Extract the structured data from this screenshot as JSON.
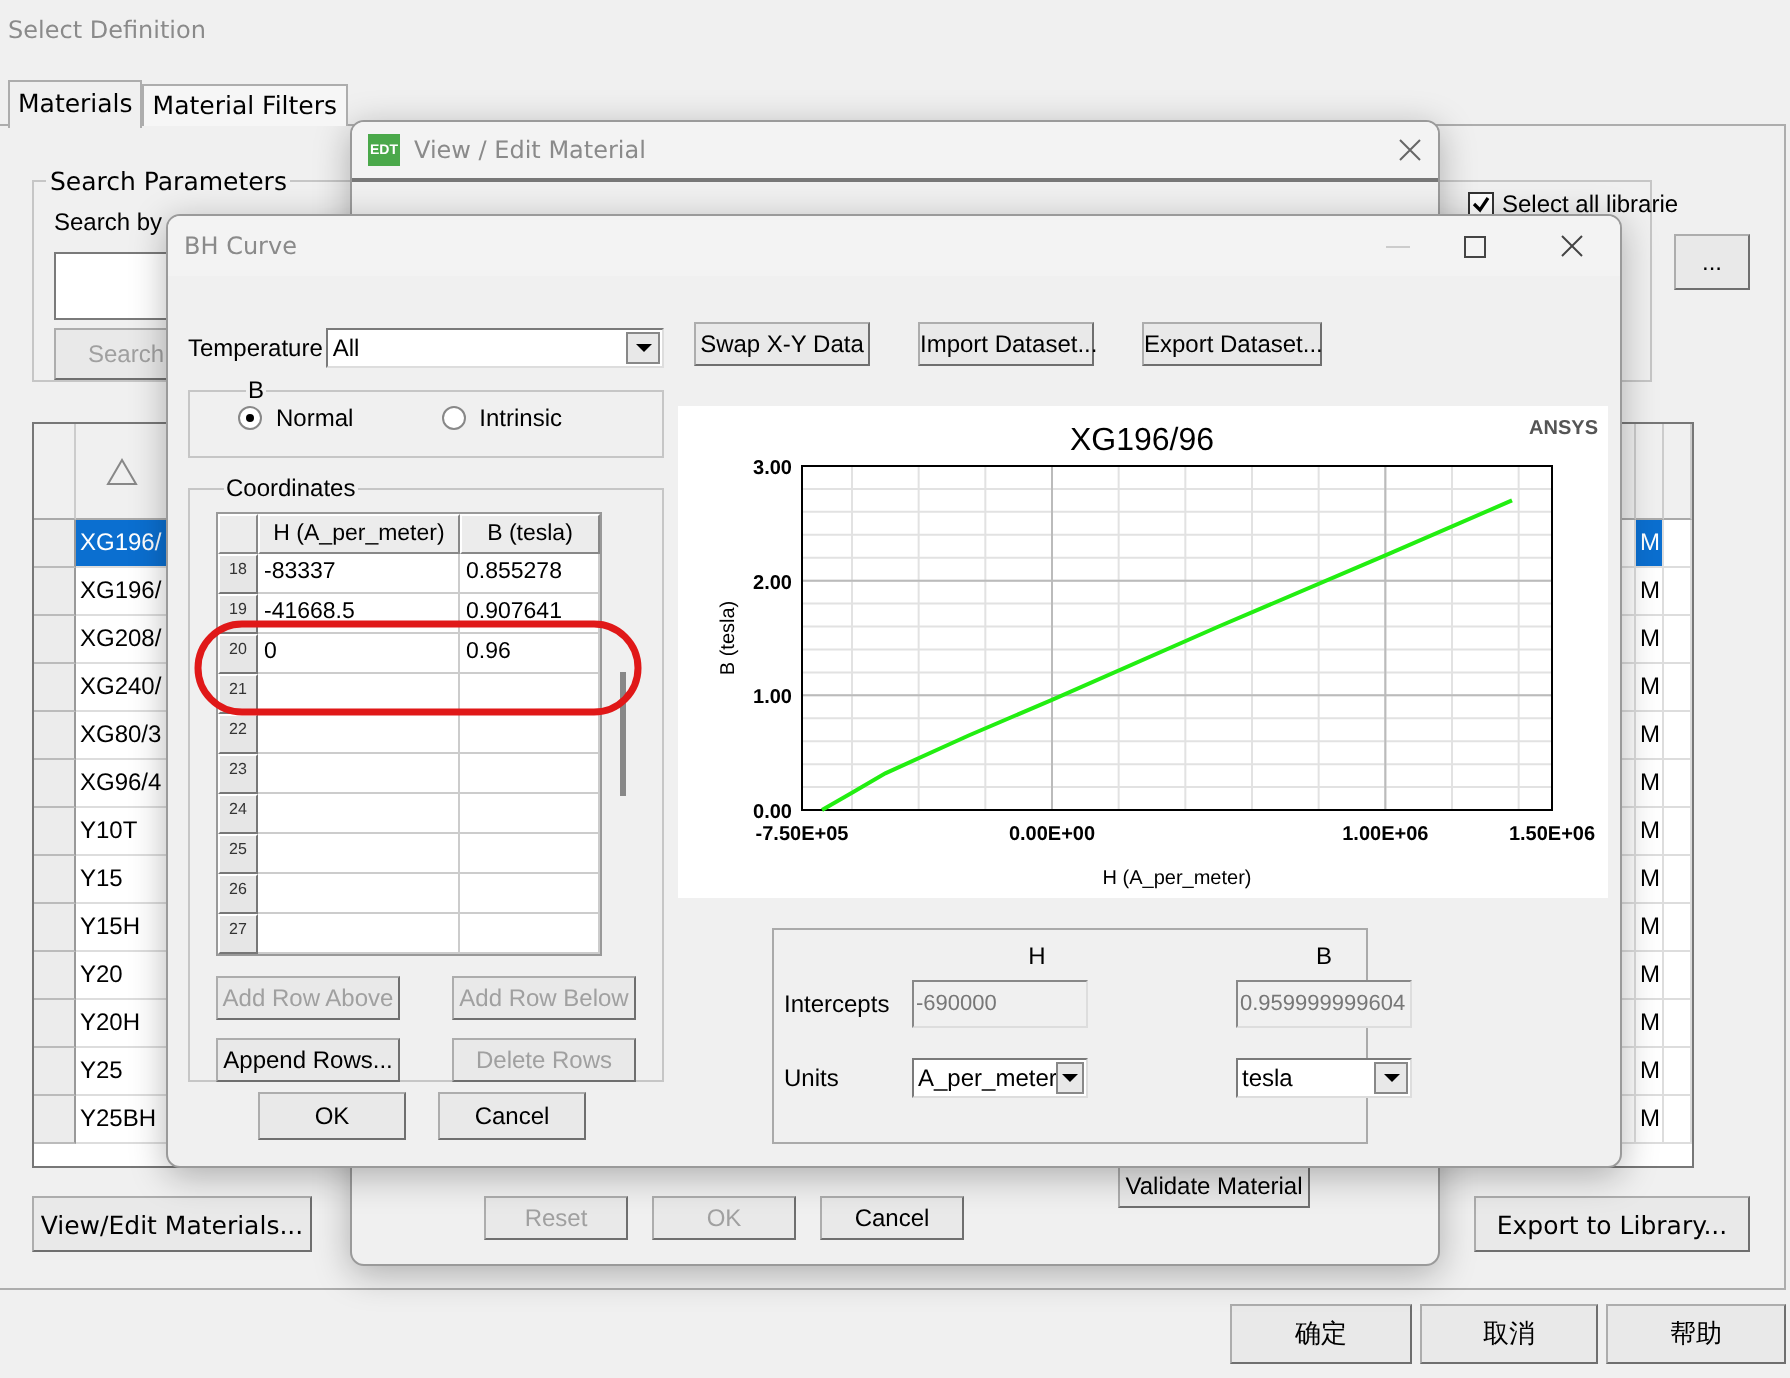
{
  "main_window": {
    "title": "Select Definition",
    "tabs": [
      {
        "label": "Materials",
        "selected": true
      },
      {
        "label": "Material Filters",
        "selected": false
      }
    ],
    "search": {
      "group_label": "Search Parameters",
      "label": "Search by",
      "button": "Search"
    },
    "select_all_libraries": {
      "label": "Select all librarie",
      "checked": true
    },
    "browse_button": "...",
    "materials": [
      {
        "name": "XG196/",
        "column_2": "M",
        "selected": true
      },
      {
        "name": "XG196/",
        "column_2": "M",
        "selected": false
      },
      {
        "name": "XG208/",
        "column_2": "M",
        "selected": false
      },
      {
        "name": "XG240/",
        "column_2": "M",
        "selected": false
      },
      {
        "name": "XG80/3",
        "column_2": "M",
        "selected": false
      },
      {
        "name": "XG96/4",
        "column_2": "M",
        "selected": false
      },
      {
        "name": "Y10T",
        "column_2": "M",
        "selected": false
      },
      {
        "name": "Y15",
        "column_2": "M",
        "selected": false
      },
      {
        "name": "Y15H",
        "column_2": "M",
        "selected": false
      },
      {
        "name": "Y20",
        "column_2": "M",
        "selected": false
      },
      {
        "name": "Y20H",
        "column_2": "M",
        "selected": false
      },
      {
        "name": "Y25",
        "column_2": "M",
        "selected": false
      },
      {
        "name": "Y25BH",
        "column_2": "M",
        "selected": false
      }
    ],
    "view_edit_button": "View/Edit Materials...",
    "export_button": "Export to Library...",
    "dialog_buttons": [
      "确定",
      "取消",
      "帮助"
    ]
  },
  "edit_window": {
    "icon_text": "EDT",
    "title": "View / Edit Material",
    "buttons": [
      {
        "label": "Reset",
        "disabled": true
      },
      {
        "label": "OK",
        "disabled": true
      },
      {
        "label": "Cancel",
        "disabled": false
      }
    ],
    "validate_button": "Validate Material"
  },
  "bh_window": {
    "title": "BH Curve",
    "temperature": {
      "label": "Temperature",
      "value": "All"
    },
    "b_group": {
      "label": "B",
      "options": [
        {
          "label": "Normal",
          "selected": true
        },
        {
          "label": "Intrinsic",
          "selected": false
        }
      ]
    },
    "coordinates": {
      "label": "Coordinates",
      "columns": [
        "H (A_per_meter)",
        "B (tesla)"
      ],
      "rows": [
        {
          "index": "18",
          "h": "-83337",
          "b": "0.855278"
        },
        {
          "index": "19",
          "h": "-41668.5",
          "b": "0.907641"
        },
        {
          "index": "20",
          "h": "0",
          "b": "0.96"
        },
        {
          "index": "21"
        },
        {
          "index": "22"
        },
        {
          "index": "23"
        },
        {
          "index": "24"
        },
        {
          "index": "25"
        },
        {
          "index": "26"
        },
        {
          "index": "27"
        }
      ]
    },
    "row_buttons": [
      {
        "label": "Add Row Above",
        "disabled": true
      },
      {
        "label": "Add Row Below",
        "disabled": true
      },
      {
        "label": "Append Rows...",
        "disabled": false
      },
      {
        "label": "Delete Rows",
        "disabled": true
      }
    ],
    "buttons": [
      "OK",
      "Cancel"
    ],
    "data_buttons": [
      "Swap X-Y Data",
      "Import Dataset...",
      "Export Dataset..."
    ],
    "chart": {
      "brand": "ANSYS",
      "chart_data": {
        "type": "line",
        "title": "XG196/96",
        "xlabel": "H (A_per_meter)",
        "ylabel": "B (tesla)",
        "xlim": [
          -750000,
          1500000
        ],
        "ylim": [
          0,
          3
        ],
        "xticks": [
          {
            "value": -750000,
            "label": "-7.50E+05"
          },
          {
            "value": 0,
            "label": "0.00E+00"
          },
          {
            "value": 1000000,
            "label": "1.00E+06"
          },
          {
            "value": 1500000,
            "label": "1.50E+06"
          }
        ],
        "yticks": [
          {
            "value": 0,
            "label": "0.00"
          },
          {
            "value": 1,
            "label": "1.00"
          },
          {
            "value": 2,
            "label": "2.00"
          },
          {
            "value": 3,
            "label": "3.00"
          }
        ],
        "x": [
          -690000,
          -600000,
          -500000,
          -250000,
          0,
          500000,
          1000000,
          1380000
        ],
        "grid": true,
        "series": [
          {
            "color": "#22ee11",
            "values": [
              0,
              0.15,
              0.32,
              0.65,
              0.96,
              1.6,
              2.22,
              2.7
            ]
          }
        ]
      }
    },
    "intercepts": {
      "columns": [
        "H",
        "B"
      ],
      "label": "Intercepts",
      "h": "-690000",
      "b": "0.959999999604",
      "units_label": "Units",
      "h_unit": "A_per_meter",
      "b_unit": "tesla"
    }
  },
  "highlight": {
    "kind": "ellipse",
    "color": "#e01818"
  }
}
